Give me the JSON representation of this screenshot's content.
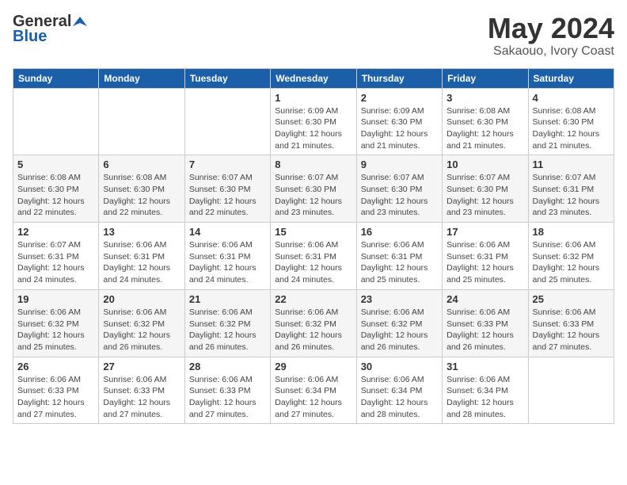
{
  "logo": {
    "general": "General",
    "blue": "Blue"
  },
  "title": "May 2024",
  "subtitle": "Sakaouo, Ivory Coast",
  "days_of_week": [
    "Sunday",
    "Monday",
    "Tuesday",
    "Wednesday",
    "Thursday",
    "Friday",
    "Saturday"
  ],
  "weeks": [
    [
      {
        "day": "",
        "detail": ""
      },
      {
        "day": "",
        "detail": ""
      },
      {
        "day": "",
        "detail": ""
      },
      {
        "day": "1",
        "detail": "Sunrise: 6:09 AM\nSunset: 6:30 PM\nDaylight: 12 hours\nand 21 minutes."
      },
      {
        "day": "2",
        "detail": "Sunrise: 6:09 AM\nSunset: 6:30 PM\nDaylight: 12 hours\nand 21 minutes."
      },
      {
        "day": "3",
        "detail": "Sunrise: 6:08 AM\nSunset: 6:30 PM\nDaylight: 12 hours\nand 21 minutes."
      },
      {
        "day": "4",
        "detail": "Sunrise: 6:08 AM\nSunset: 6:30 PM\nDaylight: 12 hours\nand 21 minutes."
      }
    ],
    [
      {
        "day": "5",
        "detail": "Sunrise: 6:08 AM\nSunset: 6:30 PM\nDaylight: 12 hours\nand 22 minutes."
      },
      {
        "day": "6",
        "detail": "Sunrise: 6:08 AM\nSunset: 6:30 PM\nDaylight: 12 hours\nand 22 minutes."
      },
      {
        "day": "7",
        "detail": "Sunrise: 6:07 AM\nSunset: 6:30 PM\nDaylight: 12 hours\nand 22 minutes."
      },
      {
        "day": "8",
        "detail": "Sunrise: 6:07 AM\nSunset: 6:30 PM\nDaylight: 12 hours\nand 23 minutes."
      },
      {
        "day": "9",
        "detail": "Sunrise: 6:07 AM\nSunset: 6:30 PM\nDaylight: 12 hours\nand 23 minutes."
      },
      {
        "day": "10",
        "detail": "Sunrise: 6:07 AM\nSunset: 6:30 PM\nDaylight: 12 hours\nand 23 minutes."
      },
      {
        "day": "11",
        "detail": "Sunrise: 6:07 AM\nSunset: 6:31 PM\nDaylight: 12 hours\nand 23 minutes."
      }
    ],
    [
      {
        "day": "12",
        "detail": "Sunrise: 6:07 AM\nSunset: 6:31 PM\nDaylight: 12 hours\nand 24 minutes."
      },
      {
        "day": "13",
        "detail": "Sunrise: 6:06 AM\nSunset: 6:31 PM\nDaylight: 12 hours\nand 24 minutes."
      },
      {
        "day": "14",
        "detail": "Sunrise: 6:06 AM\nSunset: 6:31 PM\nDaylight: 12 hours\nand 24 minutes."
      },
      {
        "day": "15",
        "detail": "Sunrise: 6:06 AM\nSunset: 6:31 PM\nDaylight: 12 hours\nand 24 minutes."
      },
      {
        "day": "16",
        "detail": "Sunrise: 6:06 AM\nSunset: 6:31 PM\nDaylight: 12 hours\nand 25 minutes."
      },
      {
        "day": "17",
        "detail": "Sunrise: 6:06 AM\nSunset: 6:31 PM\nDaylight: 12 hours\nand 25 minutes."
      },
      {
        "day": "18",
        "detail": "Sunrise: 6:06 AM\nSunset: 6:32 PM\nDaylight: 12 hours\nand 25 minutes."
      }
    ],
    [
      {
        "day": "19",
        "detail": "Sunrise: 6:06 AM\nSunset: 6:32 PM\nDaylight: 12 hours\nand 25 minutes."
      },
      {
        "day": "20",
        "detail": "Sunrise: 6:06 AM\nSunset: 6:32 PM\nDaylight: 12 hours\nand 26 minutes."
      },
      {
        "day": "21",
        "detail": "Sunrise: 6:06 AM\nSunset: 6:32 PM\nDaylight: 12 hours\nand 26 minutes."
      },
      {
        "day": "22",
        "detail": "Sunrise: 6:06 AM\nSunset: 6:32 PM\nDaylight: 12 hours\nand 26 minutes."
      },
      {
        "day": "23",
        "detail": "Sunrise: 6:06 AM\nSunset: 6:32 PM\nDaylight: 12 hours\nand 26 minutes."
      },
      {
        "day": "24",
        "detail": "Sunrise: 6:06 AM\nSunset: 6:33 PM\nDaylight: 12 hours\nand 26 minutes."
      },
      {
        "day": "25",
        "detail": "Sunrise: 6:06 AM\nSunset: 6:33 PM\nDaylight: 12 hours\nand 27 minutes."
      }
    ],
    [
      {
        "day": "26",
        "detail": "Sunrise: 6:06 AM\nSunset: 6:33 PM\nDaylight: 12 hours\nand 27 minutes."
      },
      {
        "day": "27",
        "detail": "Sunrise: 6:06 AM\nSunset: 6:33 PM\nDaylight: 12 hours\nand 27 minutes."
      },
      {
        "day": "28",
        "detail": "Sunrise: 6:06 AM\nSunset: 6:33 PM\nDaylight: 12 hours\nand 27 minutes."
      },
      {
        "day": "29",
        "detail": "Sunrise: 6:06 AM\nSunset: 6:34 PM\nDaylight: 12 hours\nand 27 minutes."
      },
      {
        "day": "30",
        "detail": "Sunrise: 6:06 AM\nSunset: 6:34 PM\nDaylight: 12 hours\nand 28 minutes."
      },
      {
        "day": "31",
        "detail": "Sunrise: 6:06 AM\nSunset: 6:34 PM\nDaylight: 12 hours\nand 28 minutes."
      },
      {
        "day": "",
        "detail": ""
      }
    ]
  ]
}
